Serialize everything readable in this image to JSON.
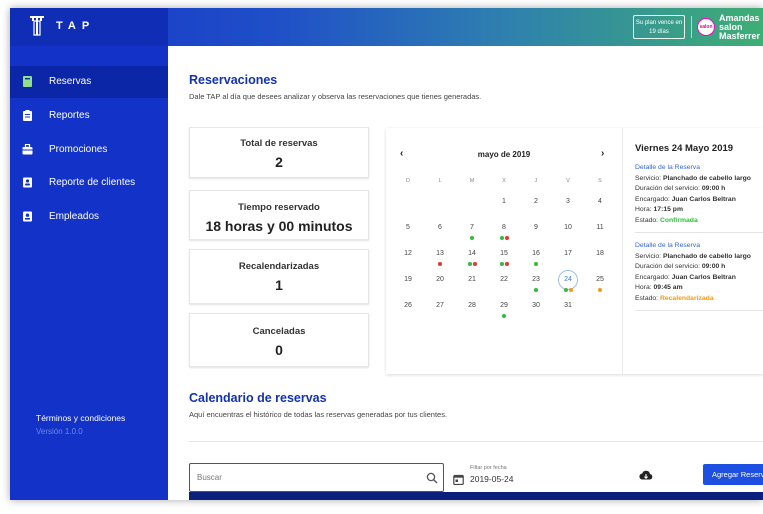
{
  "app": {
    "logo_text": "TAP"
  },
  "header": {
    "plan_notice": "Su plan vence en 19 días",
    "avatar_text": "salon",
    "user_name": "Amandas salon Masferrer"
  },
  "sidebar": {
    "items": [
      {
        "label": "Reservas",
        "icon": "calendar-book-icon",
        "active": true
      },
      {
        "label": "Reportes",
        "icon": "clipboard-icon",
        "active": false
      },
      {
        "label": "Promociones",
        "icon": "gift-icon",
        "active": false
      },
      {
        "label": "Reporte de clientes",
        "icon": "contact-card-icon",
        "active": false
      },
      {
        "label": "Empleados",
        "icon": "badge-icon",
        "active": false
      }
    ],
    "terms": "Términos y condiciones",
    "version": "Versión 1.0.0"
  },
  "main": {
    "title": "Reservaciones",
    "subtitle": "Dale TAP al día que desees analizar y observa las reservaciones que tienes generadas.",
    "stats": [
      {
        "label": "Total de reservas",
        "value": "2"
      },
      {
        "label": "Tiempo reservado",
        "value": "18 horas y 00 minutos"
      },
      {
        "label": "Recalendarizadas",
        "value": "1"
      },
      {
        "label": "Canceladas",
        "value": "0"
      }
    ],
    "calendar": {
      "month_label": "mayo de 2019",
      "weekdays": [
        "D",
        "L",
        "M",
        "X",
        "J",
        "V",
        "S"
      ],
      "weeks": [
        [
          "",
          "",
          "",
          "1",
          "2",
          "3",
          "4"
        ],
        [
          "5",
          "6",
          "7",
          "8",
          "9",
          "10",
          "11"
        ],
        [
          "12",
          "13",
          "14",
          "15",
          "16",
          "17",
          "18"
        ],
        [
          "19",
          "20",
          "21",
          "22",
          "23",
          "24",
          "25"
        ],
        [
          "26",
          "27",
          "28",
          "29",
          "30",
          "31",
          ""
        ]
      ],
      "selected_day": "24",
      "event_markers": {
        "7": [
          "green"
        ],
        "8": [
          "green",
          "red"
        ],
        "13": [
          "red"
        ],
        "14": [
          "green",
          "red"
        ],
        "15": [
          "green",
          "red"
        ],
        "16": [
          "green"
        ],
        "23": [
          "green"
        ],
        "24": [
          "green",
          "orange"
        ],
        "25": [
          "orange"
        ],
        "29": [
          "green"
        ]
      },
      "colors": {
        "green": "#2ebd3c",
        "red": "#e7352a",
        "orange": "#f29a16"
      }
    },
    "details": {
      "date_title": "Viernes 24 Mayo 2019",
      "items": [
        {
          "link": "Detalle de la Reserva",
          "service_label": "Servicio:",
          "service": "Planchado de cabello largo",
          "duration_label": "Duración del servicio:",
          "duration": "09:00 h",
          "manager_label": "Encargado:",
          "manager": "Juan Carlos Beltran",
          "time_label": "Hora:",
          "time": "17:15 pm",
          "status_label": "Estado:",
          "status": "Confirmada"
        },
        {
          "link": "Detalle de la Reserva",
          "service_label": "Servicio:",
          "service": "Planchado de cabello largo",
          "duration_label": "Duración del servicio:",
          "duration": "09:00 h",
          "manager_label": "Encargado:",
          "manager": "Juan Carlos Beltran",
          "time_label": "Hora:",
          "time": "09:45 am",
          "status_label": "Estado:",
          "status": "Recalendarizada"
        }
      ]
    },
    "history_title": "Calendario de reservas",
    "history_subtitle": "Aquí encuentras el histórico de todas las reservas generadas por tus clientes.",
    "search": {
      "placeholder": "Buscar"
    },
    "date_filter": {
      "label": "Filtar por fecha",
      "value": "2019-05-24"
    },
    "add_button": "Agregar Reservas"
  }
}
